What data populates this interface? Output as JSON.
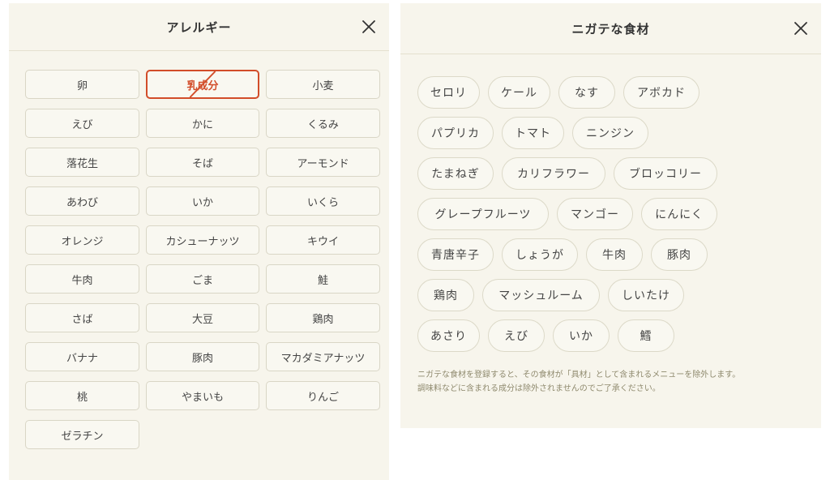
{
  "allergy": {
    "title": "アレルギー",
    "items": [
      {
        "label": "卵",
        "selected": false
      },
      {
        "label": "乳成分",
        "selected": true
      },
      {
        "label": "小麦",
        "selected": false
      },
      {
        "label": "えび",
        "selected": false
      },
      {
        "label": "かに",
        "selected": false
      },
      {
        "label": "くるみ",
        "selected": false
      },
      {
        "label": "落花生",
        "selected": false
      },
      {
        "label": "そば",
        "selected": false
      },
      {
        "label": "アーモンド",
        "selected": false
      },
      {
        "label": "あわび",
        "selected": false
      },
      {
        "label": "いか",
        "selected": false
      },
      {
        "label": "いくら",
        "selected": false
      },
      {
        "label": "オレンジ",
        "selected": false
      },
      {
        "label": "カシューナッツ",
        "selected": false
      },
      {
        "label": "キウイ",
        "selected": false
      },
      {
        "label": "牛肉",
        "selected": false
      },
      {
        "label": "ごま",
        "selected": false
      },
      {
        "label": "鮭",
        "selected": false
      },
      {
        "label": "さば",
        "selected": false
      },
      {
        "label": "大豆",
        "selected": false
      },
      {
        "label": "鶏肉",
        "selected": false
      },
      {
        "label": "バナナ",
        "selected": false
      },
      {
        "label": "豚肉",
        "selected": false
      },
      {
        "label": "マカダミアナッツ",
        "selected": false
      },
      {
        "label": "桃",
        "selected": false
      },
      {
        "label": "やまいも",
        "selected": false
      },
      {
        "label": "りんご",
        "selected": false
      },
      {
        "label": "ゼラチン",
        "selected": false
      }
    ]
  },
  "disliked": {
    "title": "ニガテな食材",
    "rows": [
      [
        "セロリ",
        "ケール",
        "なす",
        "アボカド"
      ],
      [
        "パプリカ",
        "トマト",
        "ニンジン"
      ],
      [
        "たまねぎ",
        "カリフラワー",
        "ブロッコリー"
      ],
      [
        "グレープフルーツ",
        "マンゴー",
        "にんにく"
      ],
      [
        "青唐辛子",
        "しょうが",
        "牛肉",
        "豚肉"
      ],
      [
        "鶏肉",
        "マッシュルーム",
        "しいたけ"
      ],
      [
        "あさり",
        "えび",
        "いか",
        "鱈"
      ]
    ],
    "note_line1": "ニガテな食材を登録すると、その食材が「具材」として含まれるメニューを除外します。",
    "note_line2": "調味料などに含まれる成分は除外されませんのでご了承ください。"
  },
  "colors": {
    "panel_bg": "#f7f5ec",
    "accent": "#d24d2a",
    "note_text": "#8f8a6e"
  },
  "icons": {
    "close": "close-icon"
  }
}
